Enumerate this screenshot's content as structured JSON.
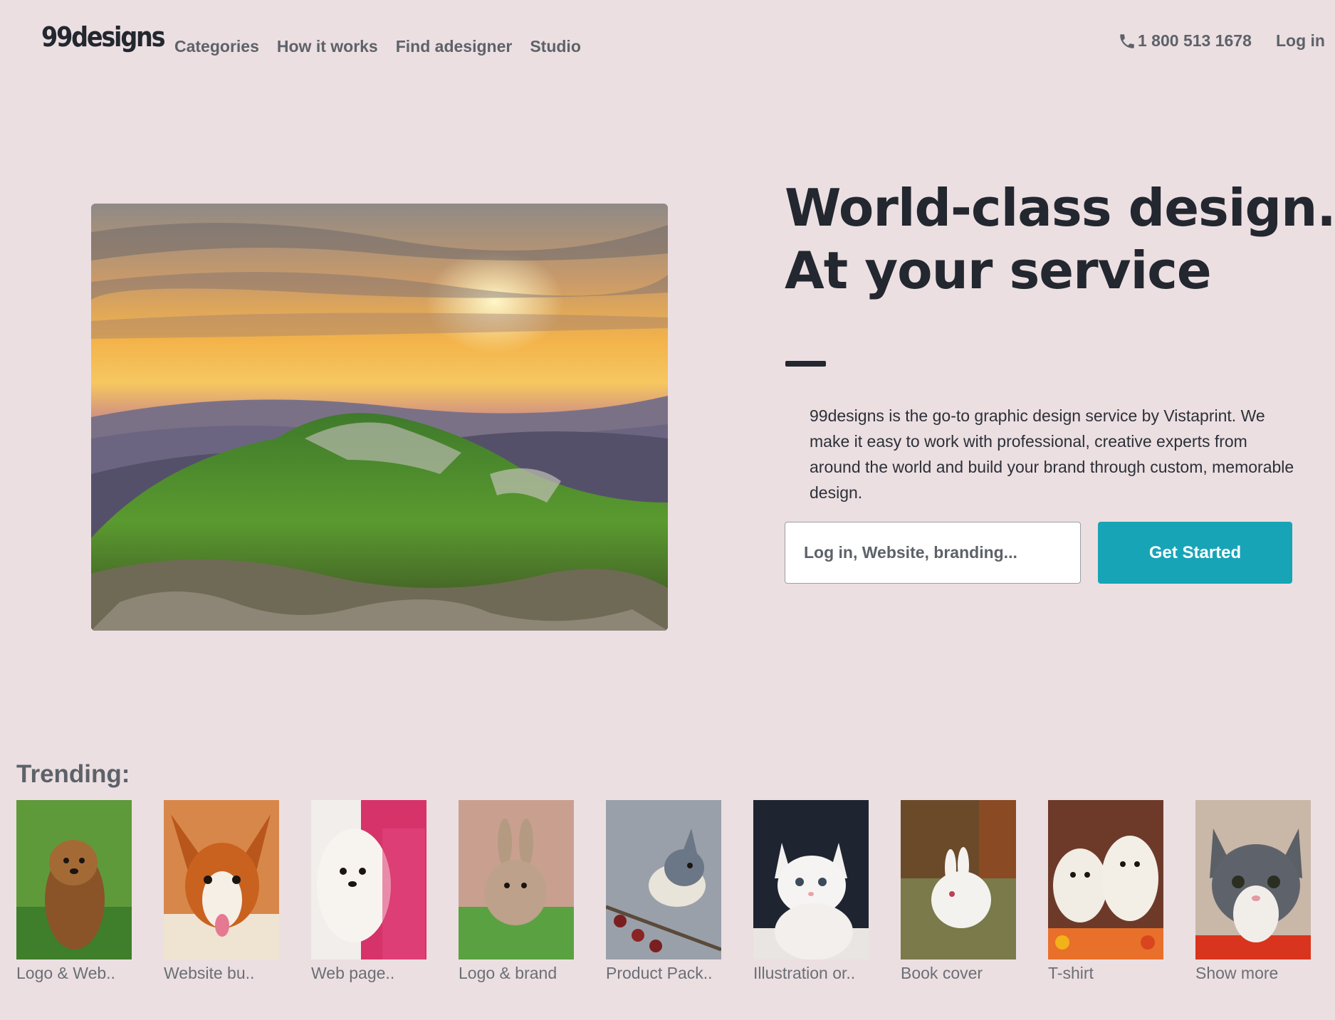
{
  "header": {
    "logo": "99designs",
    "nav": [
      {
        "label": "Categories"
      },
      {
        "label": "How it works"
      },
      {
        "label": "Find adesigner"
      },
      {
        "label": "Studio"
      }
    ],
    "phone": "1 800 513 1678",
    "phone_icon": "phone-icon",
    "login": "Log in"
  },
  "hero": {
    "headline_line1": "World-class design.",
    "headline_line2": "At your service",
    "description": "99designs is the go-to graphic design service by Vistaprint. We make it easy to work with professional, creative experts from around the world and build your brand through custom, memorable design.",
    "search_placeholder": "Log in, Website, branding...",
    "cta_label": "Get Started",
    "image_subject": "mountain sunset landscape"
  },
  "trending": {
    "label": "Trending:",
    "items": [
      {
        "label": "Logo & Web..",
        "image_subject": "brown puppy on grass"
      },
      {
        "label": "Website bu..",
        "image_subject": "papillon dog"
      },
      {
        "label": "Web page..",
        "image_subject": "white puppy on pink"
      },
      {
        "label": "Logo & brand",
        "image_subject": "bunny in grass"
      },
      {
        "label": "Product Pack..",
        "image_subject": "titmouse bird on branch"
      },
      {
        "label": "Illustration or..",
        "image_subject": "white kitten"
      },
      {
        "label": "Book cover",
        "image_subject": "white rabbit in hay"
      },
      {
        "label": "T-shirt",
        "image_subject": "two white puppies"
      },
      {
        "label": "Show more",
        "image_subject": "grey and white kitten"
      }
    ]
  },
  "colors": {
    "background": "#ecdfe1",
    "accent": "#17a4b7",
    "text_dark": "#23272f",
    "text_muted": "#5d6269"
  }
}
